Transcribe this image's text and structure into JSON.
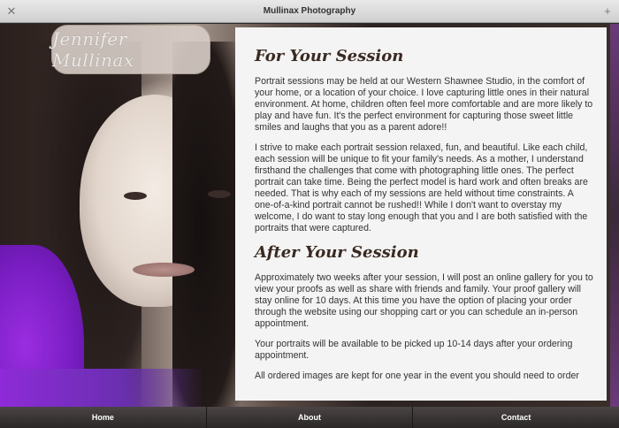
{
  "window": {
    "title": "Mullinax Photography",
    "close_icon": "close-icon",
    "add_icon": "plus-icon"
  },
  "logo": {
    "text": "Jennifer Mullinax"
  },
  "content": {
    "section1": {
      "heading": "For Your Session",
      "paragraphs": [
        "Portrait sessions may be held at our Western Shawnee Studio, in the comfort of your home, or a location of your choice. I love capturing little ones in their natural environment. At home, children often feel more comfortable and are more likely to play and have fun. It's the perfect environment for capturing those sweet little smiles and laughs that you as a parent adore!!",
        "I strive to make each portrait session relaxed, fun, and beautiful. Like each child, each session will be unique to fit your family's needs. As a mother, I understand firsthand the challenges that come with photographing little ones. The perfect portrait can take time. Being the perfect model is hard work and often breaks are needed. That is why each of my sessions are held without time constraints. A one-of-a-kind portrait cannot be rushed!! While I don't want to overstay my welcome, I do want to stay long enough that you and I are both satisfied with the portraits that were captured."
      ]
    },
    "section2": {
      "heading": "After Your Session",
      "paragraphs": [
        "Approximately two weeks after your session, I will post an online gallery for you to view your proofs as well as share with friends and family. Your proof gallery will stay online for 10 days. At this time you have the option of placing your order through the website using our shopping cart or you can schedule an in-person appointment.",
        "Your portraits will be available to be picked up 10-14 days after your ordering appointment.",
        "All ordered images are kept for one year in the event you should need to order"
      ]
    }
  },
  "nav": {
    "items": [
      "Home",
      "About",
      "Contact"
    ]
  }
}
